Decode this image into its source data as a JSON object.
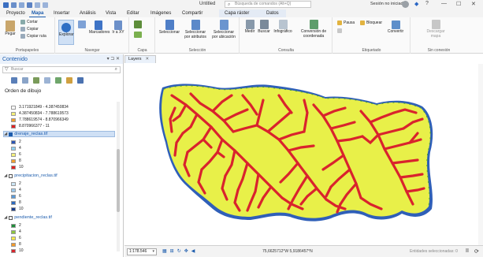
{
  "window": {
    "title": "Untitled",
    "command_search_placeholder": "Búsqueda de comandos (Alt+Q)",
    "signin_text": "Sesión no iniciada",
    "help_icon": "?",
    "minimize_icon": "—",
    "maximize_icon": "☐",
    "close_icon": "✕"
  },
  "tabs": [
    {
      "label": "Proyecto"
    },
    {
      "label": "Mapa",
      "active": true
    },
    {
      "label": "Insertar"
    },
    {
      "label": "Análisis"
    },
    {
      "label": "Vista"
    },
    {
      "label": "Editar"
    },
    {
      "label": "Imágenes"
    },
    {
      "label": "Compartir"
    },
    {
      "label": "Capa ráster"
    },
    {
      "label": "Datos"
    }
  ],
  "ribbon": {
    "portapapeles": {
      "label": "Portapapeles",
      "pegar": "Pegar",
      "cortar": "Cortar",
      "copiar": "Copiar",
      "copiar_ruta": "Copiar ruta"
    },
    "navegar": {
      "label": "Navegar",
      "explorar": "Explorar",
      "marcadores": "Marcadores",
      "ir_a_xy": "Ir a XY"
    },
    "capa": {
      "label": "Capa"
    },
    "seleccion": {
      "label": "Selección",
      "seleccionar": "Seleccionar",
      "por_atributos": "Seleccionar por atributos",
      "por_ubicacion": "Seleccionar por ubicación"
    },
    "consulta": {
      "label": "Consulta",
      "medir": "Medir",
      "buscar": "Buscar",
      "infografico": "Infográfico",
      "conversion": "Conversión de coordenada"
    },
    "etiquetado": {
      "label": "Etiquetado",
      "pausa": "Pausa",
      "bloquear": "Bloquear",
      "convertir": "Convertir"
    },
    "sin_conexion": {
      "label": "Sin conexión",
      "descargar": "Descargar mapa"
    }
  },
  "contents_pane": {
    "title": "Contenido",
    "search_placeholder": "Buscar",
    "drawing_order_title": "Orden de dibujo",
    "top_legend": [
      {
        "label": "3.171921849 - 4.387450834",
        "color": "#ffffff"
      },
      {
        "label": "4.387450834 - 7.788619573",
        "color": "#f5f07a"
      },
      {
        "label": "7.788619574 - 8.870966349",
        "color": "#f0a030"
      },
      {
        "label": "8.870966377 - 11",
        "color": "#e02020"
      }
    ],
    "layers": [
      {
        "name": "drenaje_reclas.tif",
        "checked": true,
        "selected": true,
        "classes": [
          {
            "label": "2",
            "color": "#2a55b5"
          },
          {
            "label": "4",
            "color": "#8fd0f0"
          },
          {
            "label": "6",
            "color": "#f5f07a"
          },
          {
            "label": "8",
            "color": "#f0a030"
          },
          {
            "label": "10",
            "color": "#e02020"
          }
        ]
      },
      {
        "name": "precipitacion_reclas.tif",
        "checked": false,
        "selected": false,
        "classes": [
          {
            "label": "2",
            "color": "#cde6f5"
          },
          {
            "label": "4",
            "color": "#9cc9ec"
          },
          {
            "label": "6",
            "color": "#5a9ad8"
          },
          {
            "label": "8",
            "color": "#2d6abf"
          },
          {
            "label": "10",
            "color": "#173b8c"
          }
        ]
      },
      {
        "name": "pendiente_reclas.tif",
        "checked": false,
        "selected": false,
        "classes": [
          {
            "label": "2",
            "color": "#1f8f3a"
          },
          {
            "label": "4",
            "color": "#8cc63f"
          },
          {
            "label": "6",
            "color": "#f5e94a"
          },
          {
            "label": "8",
            "color": "#f39a2b"
          },
          {
            "label": "10",
            "color": "#d8262e"
          }
        ]
      }
    ]
  },
  "map_view": {
    "tab_label": "Layers",
    "close_icon": "✕",
    "colors": {
      "terrain": "#e8f049",
      "drainage": "#d9232d",
      "water": "#2f5fb8",
      "edge": "#4c9a3c"
    }
  },
  "statusbar": {
    "scale": "1:178.546",
    "coordinates": "75,6625712°W 5,9186457°N",
    "selected_features": "Entidades seleccionadas: 0",
    "pause_icon": "II",
    "refresh_icon": "⟳"
  }
}
